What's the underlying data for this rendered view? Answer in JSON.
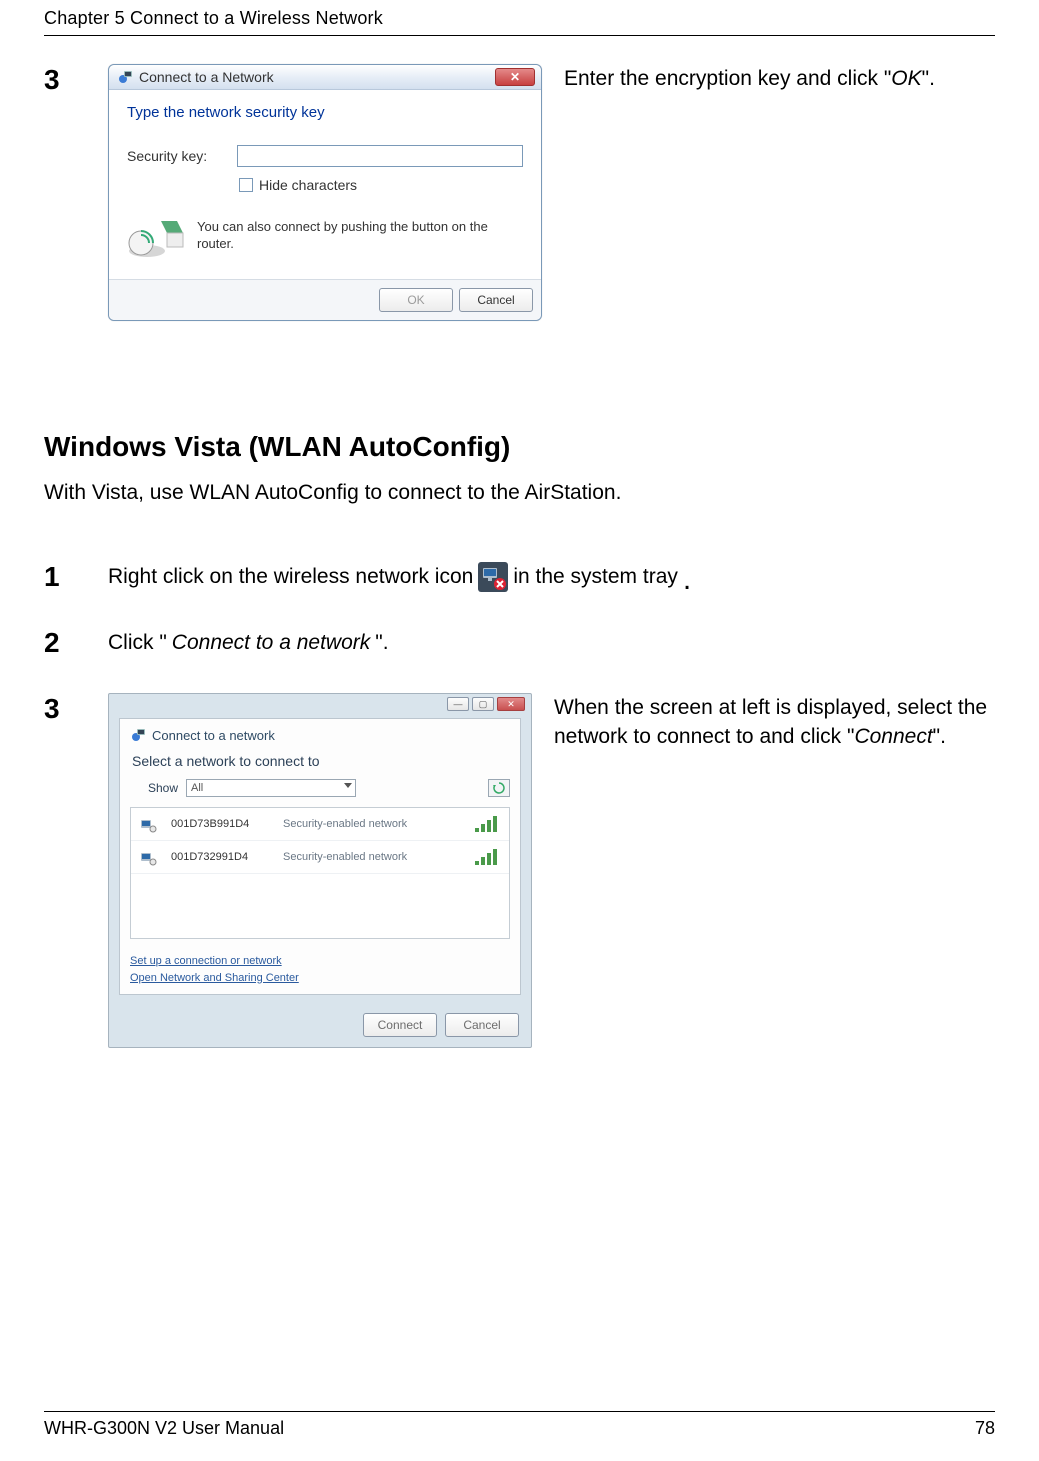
{
  "header": {
    "chapter": "Chapter 5  Connect to a Wireless Network"
  },
  "step3a": {
    "number": "3",
    "side_text_pre": "Enter the encryption key and click \"",
    "side_text_italic": "OK",
    "side_text_post": "\"."
  },
  "dialog1": {
    "title": "Connect to a Network",
    "close": "✕",
    "heading": "Type the network security key",
    "label_key": "Security key:",
    "input_value": "",
    "hide_chars": "Hide characters",
    "push_text": "You can also connect by pushing the button on the router.",
    "ok": "OK",
    "cancel": "Cancel"
  },
  "section": {
    "h2": "Windows Vista (WLAN AutoConfig)",
    "intro": "With Vista, use WLAN AutoConfig to connect to the AirStation."
  },
  "step1": {
    "number": "1",
    "pre": "Right click on the wireless network icon",
    "post": "in the system tray"
  },
  "step2": {
    "number": "2",
    "pre": "Click \"",
    "italic": "Connect to a network",
    "post": "\"."
  },
  "step3b": {
    "number": "3",
    "side_pre": "When the screen at left is displayed, select the network to connect to and click \"",
    "side_italic": "Connect",
    "side_post": "\"."
  },
  "vista": {
    "titlebar": "Connect to a network",
    "subtitle": "Select a network to connect to",
    "show_label": "Show",
    "show_value": "All",
    "networks": [
      {
        "name": "001D73B991D4",
        "status": "Security-enabled network"
      },
      {
        "name": "001D732991D4",
        "status": "Security-enabled network"
      }
    ],
    "link1": "Set up a connection or network",
    "link2": "Open Network and Sharing Center",
    "connect": "Connect",
    "cancel": "Cancel"
  },
  "footer": {
    "manual": "WHR-G300N V2 User Manual",
    "page": "78"
  }
}
